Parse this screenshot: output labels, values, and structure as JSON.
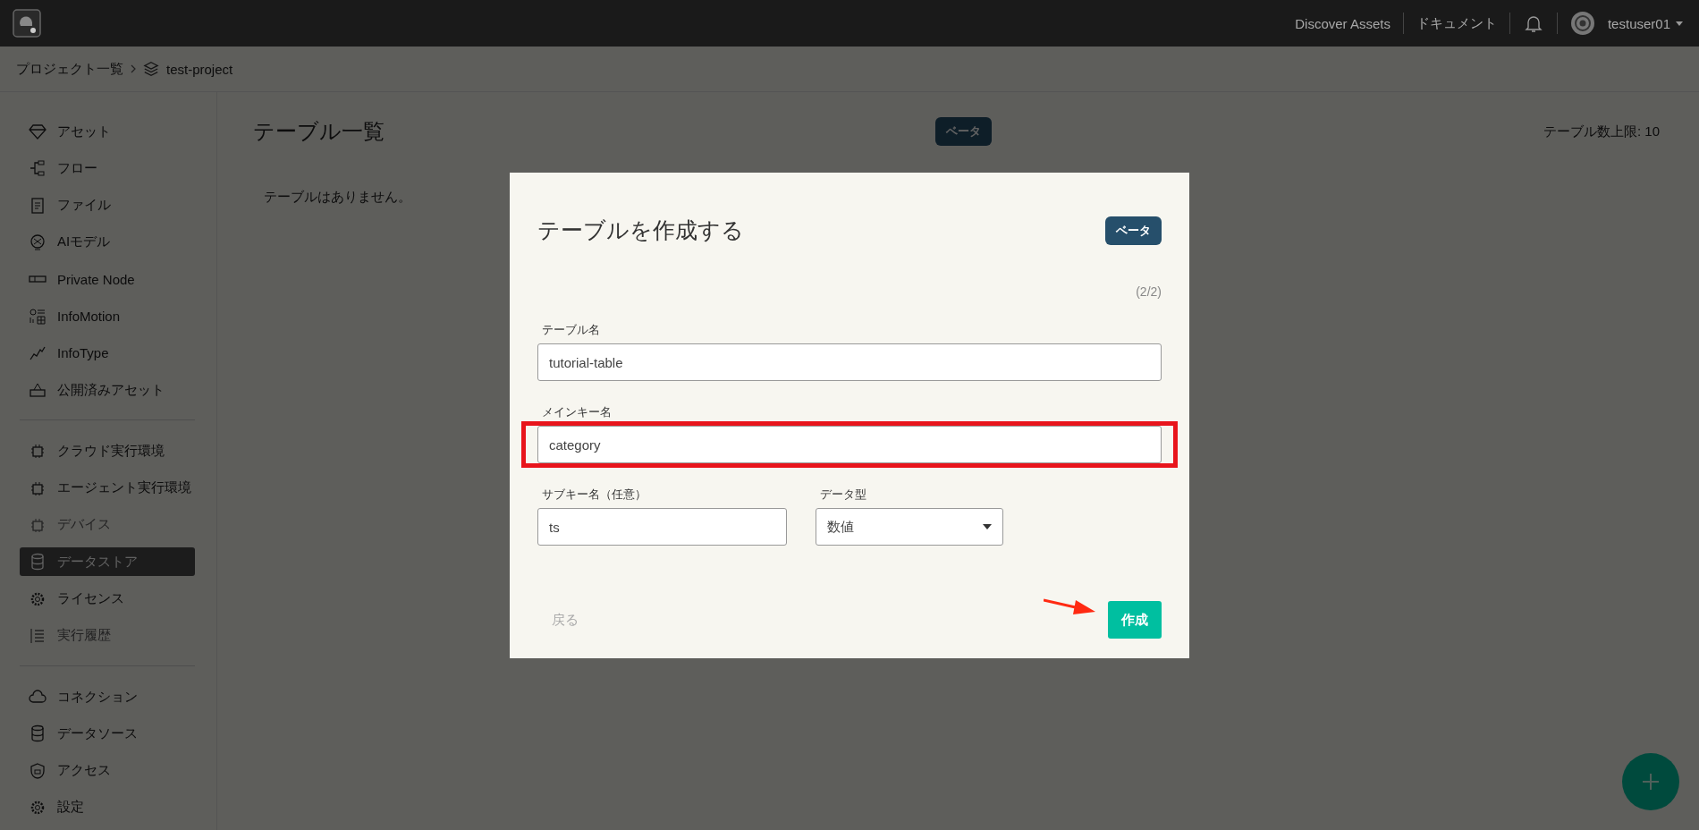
{
  "top_bar": {
    "links": [
      {
        "label": "Discover Assets"
      },
      {
        "label": "ドキュメント"
      }
    ],
    "user": {
      "name": "testuser01"
    }
  },
  "breadcrumb": [
    {
      "label": "プロジェクト一覧"
    },
    {
      "label": "test-project"
    }
  ],
  "sidebar": {
    "groups": [
      [
        {
          "label": "アセット",
          "selected": false,
          "disabled": false
        },
        {
          "label": "フロー",
          "selected": false,
          "disabled": false
        },
        {
          "label": "ファイル",
          "selected": false,
          "disabled": false
        },
        {
          "label": "AIモデル",
          "selected": false,
          "disabled": false
        },
        {
          "label": "Private Node",
          "selected": false,
          "disabled": false
        },
        {
          "label": "InfoMotion",
          "selected": false,
          "disabled": false
        },
        {
          "label": "InfoType",
          "selected": false,
          "disabled": false
        },
        {
          "label": "公開済みアセット",
          "selected": false,
          "disabled": false
        }
      ],
      [
        {
          "label": "クラウド実行環境",
          "selected": false,
          "disabled": false
        },
        {
          "label": "エージェント実行環境",
          "selected": false,
          "disabled": false
        },
        {
          "label": "デバイス",
          "selected": false,
          "disabled": true
        },
        {
          "label": "データストア",
          "selected": true,
          "disabled": false
        },
        {
          "label": "ライセンス",
          "selected": false,
          "disabled": false
        },
        {
          "label": "実行履歴",
          "selected": false,
          "disabled": true
        }
      ],
      [
        {
          "label": "コネクション",
          "selected": false,
          "disabled": false
        },
        {
          "label": "データソース",
          "selected": false,
          "disabled": false
        },
        {
          "label": "アクセス",
          "selected": false,
          "disabled": false
        },
        {
          "label": "設定",
          "selected": false,
          "disabled": false
        }
      ]
    ]
  },
  "page": {
    "title": "テーブル一覧",
    "badge": "ベータ",
    "limit": "テーブル数上限: 10",
    "empty_message": "テーブルはありません。"
  },
  "dialog": {
    "title": "テーブルを作成する",
    "badge": "ベータ",
    "step": "(2/2)",
    "fields": [
      {
        "kind": "text",
        "label": "テーブル名",
        "value": "tutorial-table",
        "highlighted": false
      },
      {
        "kind": "text",
        "label": "メインキー名",
        "value": "category",
        "highlighted": true
      }
    ],
    "row_fields": [
      {
        "kind": "text",
        "label": "サブキー名（任意）",
        "value": "ts",
        "highlighted": false
      },
      {
        "kind": "select",
        "label": "データ型",
        "value": "数値",
        "highlighted": false
      }
    ],
    "back_button": {
      "label": "戻る",
      "disabled": true
    },
    "create_button": {
      "label": "作成",
      "pointed": true
    }
  }
}
